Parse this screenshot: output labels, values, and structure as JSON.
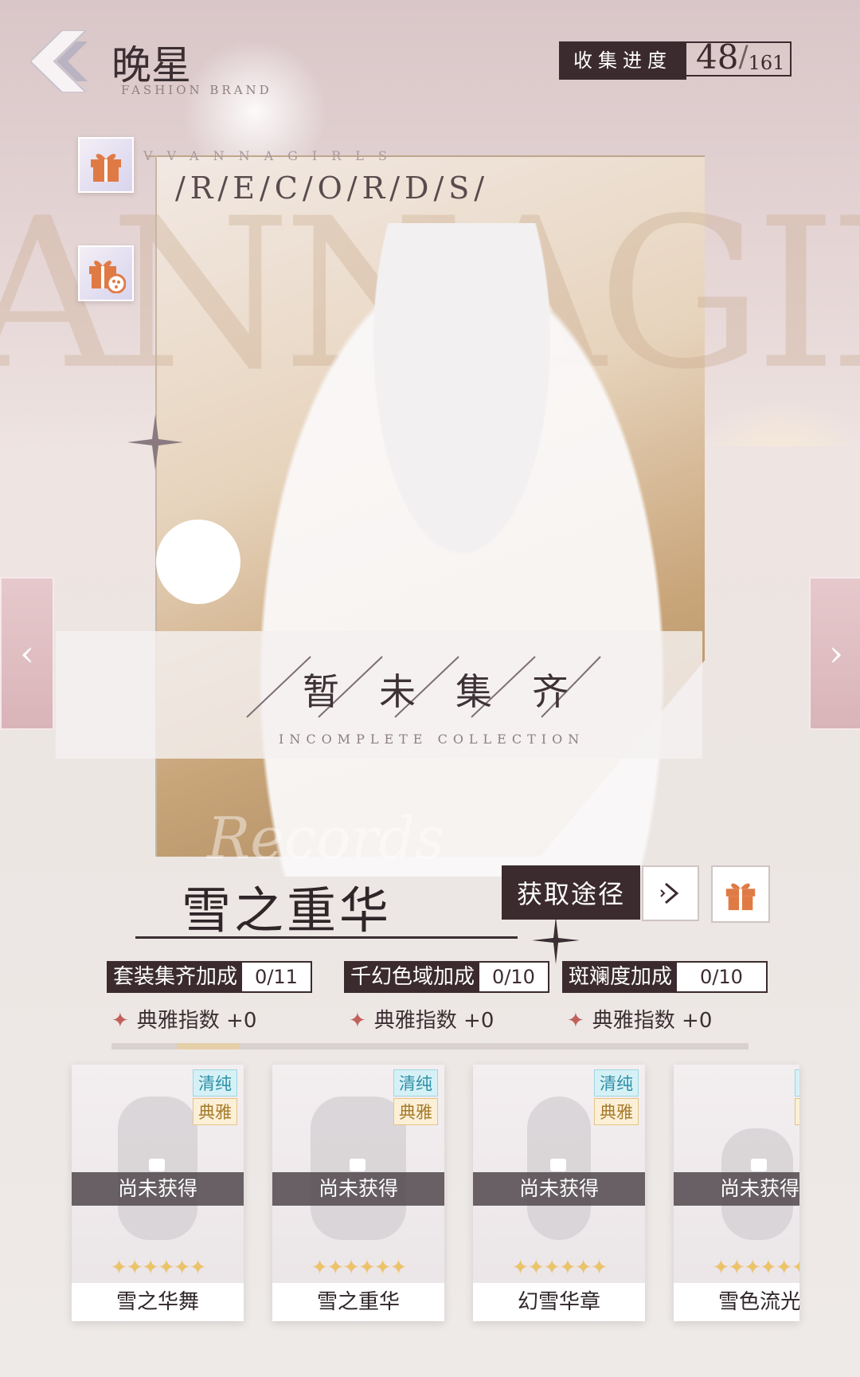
{
  "header": {
    "brand_title": "晚星",
    "brand_subtitle": "FASHION BRAND",
    "progress_label": "收集进度",
    "progress_current": "48",
    "progress_separator": "/",
    "progress_total": "161"
  },
  "records": {
    "top_text": "VVANNAGIRLS",
    "title": "/R/E/C/O/R/D/S/",
    "background_letters": "ANNAGIR",
    "script_text": "Records"
  },
  "status": {
    "title": "暂未集齐",
    "subtitle": "INCOMPLETE   COLLECTION"
  },
  "set": {
    "name": "雪之重华",
    "obtain_label": "获取途径"
  },
  "bonuses": [
    {
      "label": "套装集齐加成",
      "value": "0/11",
      "effect": "典雅指数 +0"
    },
    {
      "label": "千幻色域加成",
      "value": "0/10",
      "effect": "典雅指数 +0"
    },
    {
      "label": "斑斓度加成",
      "value": "0/10",
      "effect": "典雅指数 +0"
    }
  ],
  "items": [
    {
      "name": "雪之华舞",
      "tag1": "清纯",
      "tag2": "典雅",
      "status": "尚未获得",
      "stars": "✦✦✦✦✦✦"
    },
    {
      "name": "雪之重华",
      "tag1": "清纯",
      "tag2": "典雅",
      "status": "尚未获得",
      "stars": "✦✦✦✦✦✦"
    },
    {
      "name": "幻雪华章",
      "tag1": "清纯",
      "tag2": "典雅",
      "status": "尚未获得",
      "stars": "✦✦✦✦✦✦"
    },
    {
      "name": "雪色流光",
      "tag1": "清纯",
      "tag2": "典雅",
      "status": "尚未获得",
      "stars": "✦✦✦✦✦✦"
    }
  ],
  "nav": {
    "prev": "‹",
    "next": "›"
  },
  "colors": {
    "dark": "#3b2b2e",
    "gift": "#e07a45",
    "tag_blue": "#2e8fa6",
    "tag_gold": "#a77a2a"
  }
}
